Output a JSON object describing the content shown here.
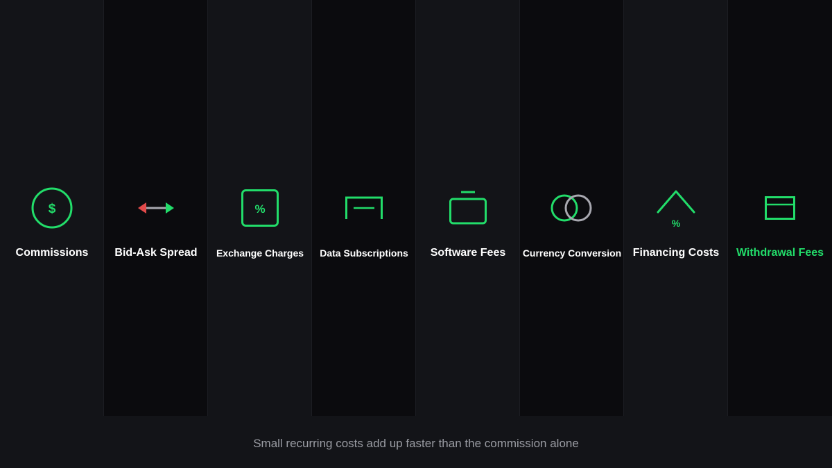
{
  "colors": {
    "accent": "#22dd6a",
    "spread_left": "#e24a4a",
    "neutral": "#a8a8b0",
    "text": "#ffffff",
    "caption": "#9a9ca3"
  },
  "items": [
    {
      "label": "Commissions",
      "icon": "dollar-circle-icon",
      "icon_text": "$"
    },
    {
      "label": "Bid-Ask Spread",
      "icon": "double-arrow-icon"
    },
    {
      "label": "Exchange Charges",
      "icon": "percent-square-icon",
      "icon_text": "%"
    },
    {
      "label": "Data Subscriptions",
      "icon": "data-feed-icon"
    },
    {
      "label": "Software Fees",
      "icon": "software-box-icon"
    },
    {
      "label": "Currency Conversion",
      "icon": "overlapping-circles-icon"
    },
    {
      "label": "Financing Costs",
      "icon": "chevron-up-percent-icon",
      "icon_text": "%"
    },
    {
      "label": "Withdrawal Fees",
      "icon": "withdrawal-card-icon"
    }
  ],
  "caption": "Small recurring costs add up faster than the commission alone"
}
